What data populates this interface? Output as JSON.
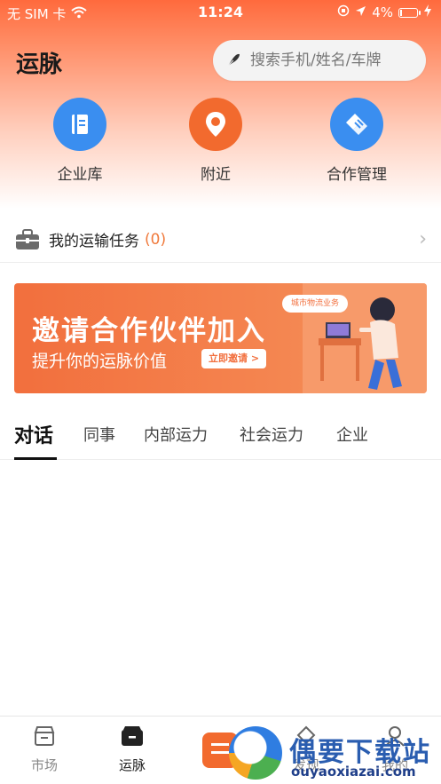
{
  "status_bar": {
    "carrier": "无 SIM 卡",
    "time": "11:24",
    "battery": "4%"
  },
  "header": {
    "title": "运脉",
    "search_placeholder": "搜索手机/姓名/车牌"
  },
  "quick_actions": [
    {
      "label": "企业库",
      "icon": "notebook-icon",
      "color": "#3a8ef0"
    },
    {
      "label": "附近",
      "icon": "location-pin-icon",
      "color": "#f26a2e"
    },
    {
      "label": "合作管理",
      "icon": "handshake-icon",
      "color": "#3a8ef0"
    }
  ],
  "tasks": {
    "label": "我的运输任务",
    "count": "(0)"
  },
  "banner": {
    "headline": "邀请合作伙伴加入",
    "sub": "提升你的运脉价值",
    "cta": "立即邀请 >",
    "tag": "城市物流业务"
  },
  "tabs": [
    "对话",
    "同事",
    "内部运力",
    "社会运力",
    "企业"
  ],
  "bottom_nav": [
    {
      "label": "市场",
      "icon": "market-icon"
    },
    {
      "label": "运脉",
      "icon": "network-icon"
    },
    {
      "label": "",
      "icon": "center-menu-icon"
    },
    {
      "label": "发现",
      "icon": "discover-icon"
    },
    {
      "label": "我的",
      "icon": "profile-icon"
    }
  ],
  "watermark": {
    "title": "偶要下载站",
    "url": "ouyaoxiazai.com"
  },
  "colors": {
    "accent": "#f26a2e",
    "blue": "#3a8ef0"
  }
}
